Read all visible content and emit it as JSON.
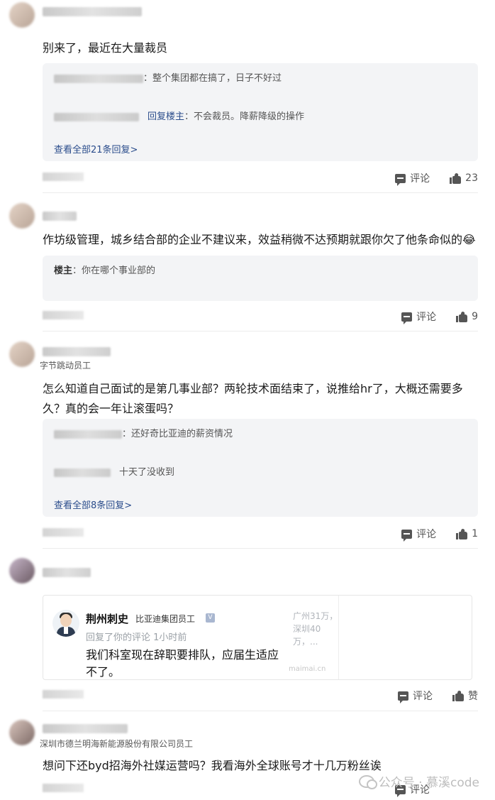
{
  "comments": [
    {
      "text": "别来了，最近在大量裁员",
      "replies": [
        {
          "text": "：整个集团都在搞了，日子不好过"
        },
        {
          "reply_to": "回复楼主",
          "text": "：不会裁员。降薪降级的操作"
        }
      ],
      "view_all": "查看全部21条回复>",
      "comment_label": "评论",
      "likes": "23"
    },
    {
      "text": "作坊级管理，城乡结合部的企业不建议来，效益稍微不达预期就跟你欠了他条命似的😂",
      "replies": [
        {
          "host_label": "楼主",
          "text": "：你在哪个事业部的"
        }
      ],
      "comment_label": "评论",
      "likes": "9"
    },
    {
      "company": "字节跳动员工",
      "text": "怎么知道自己面试的是第几事业部？两轮技术面结束了，说推给hr了，大概还需要多久？真的会一年让滚蛋吗？",
      "replies": [
        {
          "text": "：还好奇比亚迪的薪资情况"
        },
        {
          "text": "十天了没收到"
        }
      ],
      "view_all": "查看全部8条回复>",
      "comment_label": "评论",
      "likes": "1"
    },
    {
      "card": {
        "name": "荆州刺史",
        "company": "比亚迪集团员工",
        "verify": "V",
        "subline": "回复了你的评论  1小时前",
        "text": "我们科室现在辞职要排队，应届生适应不了。",
        "side_text": "广州31万，深圳40万，...",
        "watermark": "maimai.cn"
      },
      "comment_label": "评论",
      "likes": "赞"
    },
    {
      "company": "深圳市德兰明海新能源股份有限公司员工",
      "text": "想问下还byd招海外社媒运营吗？我看海外全球账号才十几万粉丝诶",
      "comment_label": "评论"
    }
  ],
  "watermark": "公众号 · 慕溪code"
}
